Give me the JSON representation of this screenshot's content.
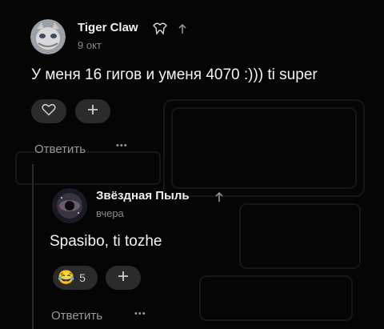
{
  "comment": {
    "author": "Tiger Claw",
    "date": "9 окт",
    "text": "У меня 16 гигов и уменя 4070 :))) ti super",
    "reply_label": "Ответить",
    "more_label": "•••",
    "like_icon": "heart-icon",
    "add_reaction_icon": "plus-icon"
  },
  "reply": {
    "author": "Звёздная Пыль",
    "date": "вчера",
    "text": "Spasibo, ti tozhe",
    "reaction_emoji": "😂",
    "reaction_count": "5",
    "reply_label": "Ответить",
    "more_label": "•••",
    "add_reaction_icon": "plus-icon"
  },
  "colors": {
    "background": "#050505",
    "pill": "#2b2b2b",
    "muted": "#9a9a9a"
  }
}
